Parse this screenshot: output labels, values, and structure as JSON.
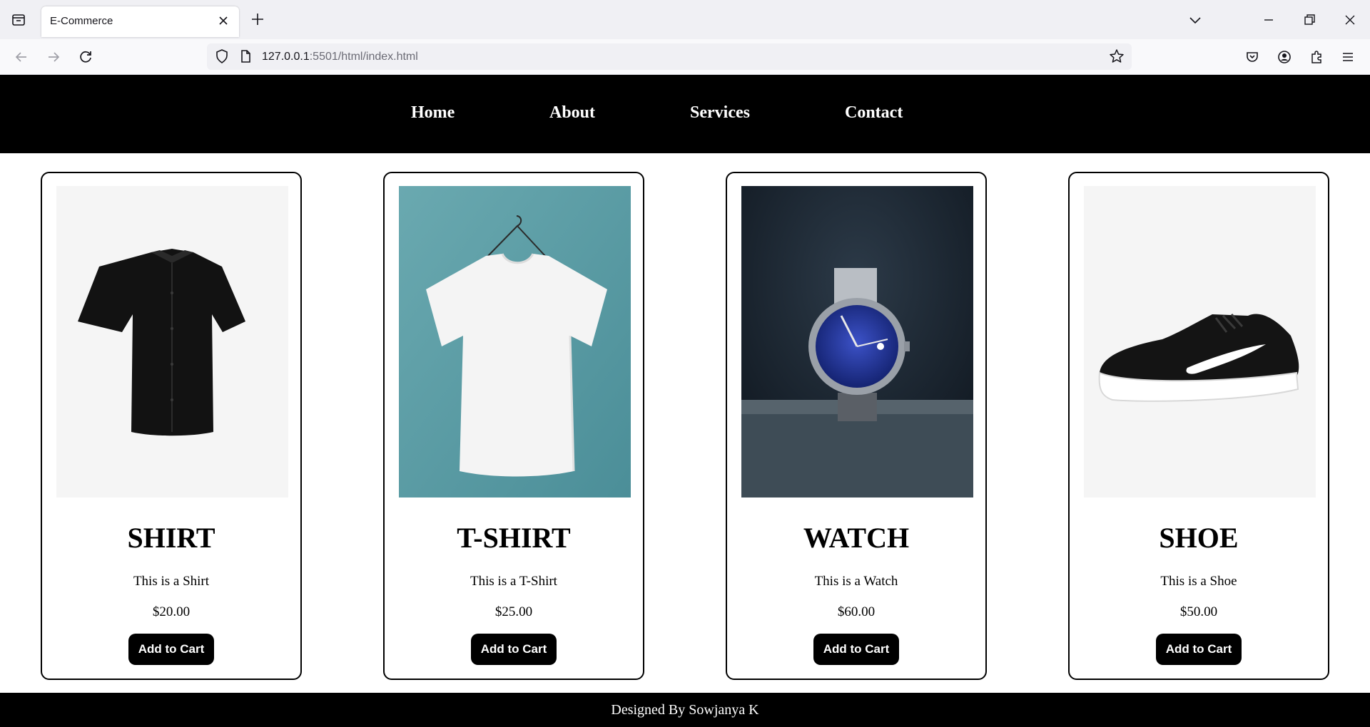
{
  "browser": {
    "tab_title": "E-Commerce",
    "url_host": "127.0.0.1",
    "url_rest": ":5501/html/index.html"
  },
  "nav": {
    "links": [
      "Home",
      "About",
      "Services",
      "Contact"
    ]
  },
  "products": [
    {
      "name": "SHIRT",
      "description": "This is a Shirt",
      "price": "$20.00",
      "button": "Add to Cart",
      "image": "black-shirt"
    },
    {
      "name": "T-SHIRT",
      "description": "This is a T-Shirt",
      "price": "$25.00",
      "button": "Add to Cart",
      "image": "white-tshirt"
    },
    {
      "name": "WATCH",
      "description": "This is a Watch",
      "price": "$60.00",
      "button": "Add to Cart",
      "image": "wrist-watch"
    },
    {
      "name": "SHOE",
      "description": "This is a Shoe",
      "price": "$50.00",
      "button": "Add to Cart",
      "image": "sneaker"
    }
  ],
  "footer": {
    "text": "Designed By Sowjanya K"
  },
  "colors": {
    "header_bg": "#000000",
    "button_bg": "#000000",
    "tshirt_bg": "#5d9ea6",
    "watch_dial": "#1a2a8c"
  }
}
